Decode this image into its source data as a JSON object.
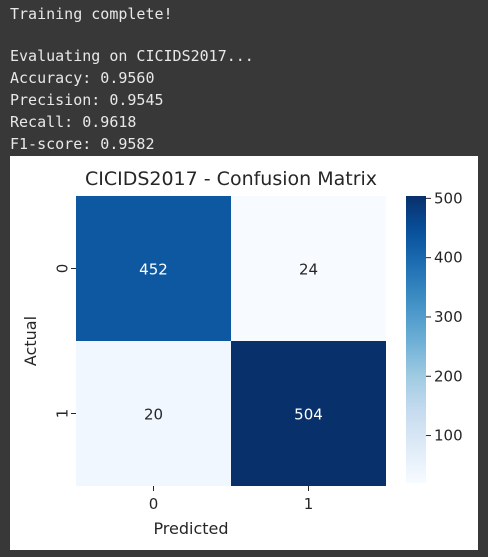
{
  "console": {
    "lines": [
      "Training complete!",
      "",
      "Evaluating on CICIDS2017...",
      "Accuracy: 0.9560",
      "Precision: 0.9545",
      "Recall: 0.9618",
      "F1-score: 0.9582"
    ]
  },
  "chart_data": {
    "type": "heatmap",
    "title": "CICIDS2017 - Confusion Matrix",
    "xlabel": "Predicted",
    "ylabel": "Actual",
    "x_categories": [
      "0",
      "1"
    ],
    "y_categories": [
      "0",
      "1"
    ],
    "values": [
      [
        452,
        24
      ],
      [
        20,
        504
      ]
    ],
    "colormap": "Blues",
    "colorbar": {
      "ticks": [
        "100",
        "200",
        "300",
        "400",
        "500"
      ],
      "range": [
        20,
        504
      ]
    },
    "cell_colors": [
      [
        "#0d58a1",
        "#f7fbff"
      ],
      [
        "#f1f7fe",
        "#08306b"
      ]
    ],
    "annotation_colors": [
      [
        "#ffffff",
        "#262626"
      ],
      [
        "#262626",
        "#ffffff"
      ]
    ]
  }
}
